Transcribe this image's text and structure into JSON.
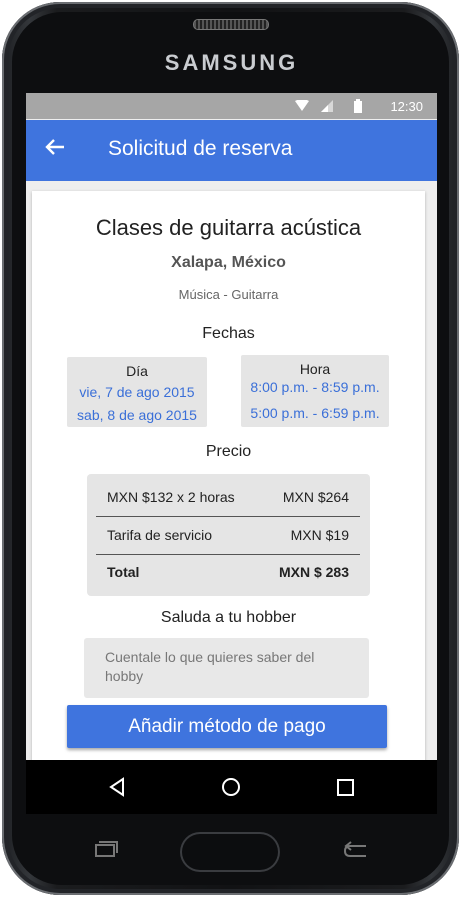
{
  "device": {
    "brand": "SAMSUNG"
  },
  "statusbar": {
    "time": "12:30"
  },
  "appbar": {
    "back_icon": "arrow-left-icon",
    "title": "Solicitud de reserva"
  },
  "listing": {
    "title": "Clases de guitarra acústica",
    "location": "Xalapa, México",
    "category": "Música - Guitarra"
  },
  "fechas": {
    "heading": "Fechas",
    "dia_label": "Día",
    "dias": [
      "vie, 7 de ago 2015",
      "sab, 8 de ago 2015"
    ],
    "hora_label": "Hora",
    "horas": [
      "8:00 p.m. - 8:59 p.m.",
      "5:00 p.m. - 6:59 p.m."
    ]
  },
  "precio": {
    "heading": "Precio",
    "rows": [
      {
        "label": "MXN $132 x 2 horas",
        "value": "MXN $264"
      },
      {
        "label": "Tarifa de servicio",
        "value": "MXN $19"
      },
      {
        "label": "Total",
        "value": "MXN $ 283"
      }
    ]
  },
  "mensaje": {
    "heading": "Saluda a tu hobber",
    "placeholder": "Cuentale lo que quieres saber del hobby"
  },
  "cta": {
    "label": "Añadir método de pago"
  },
  "colors": {
    "primary": "#3f74de",
    "link": "#3a6fd8",
    "statusbar": "#a6a6a6"
  }
}
